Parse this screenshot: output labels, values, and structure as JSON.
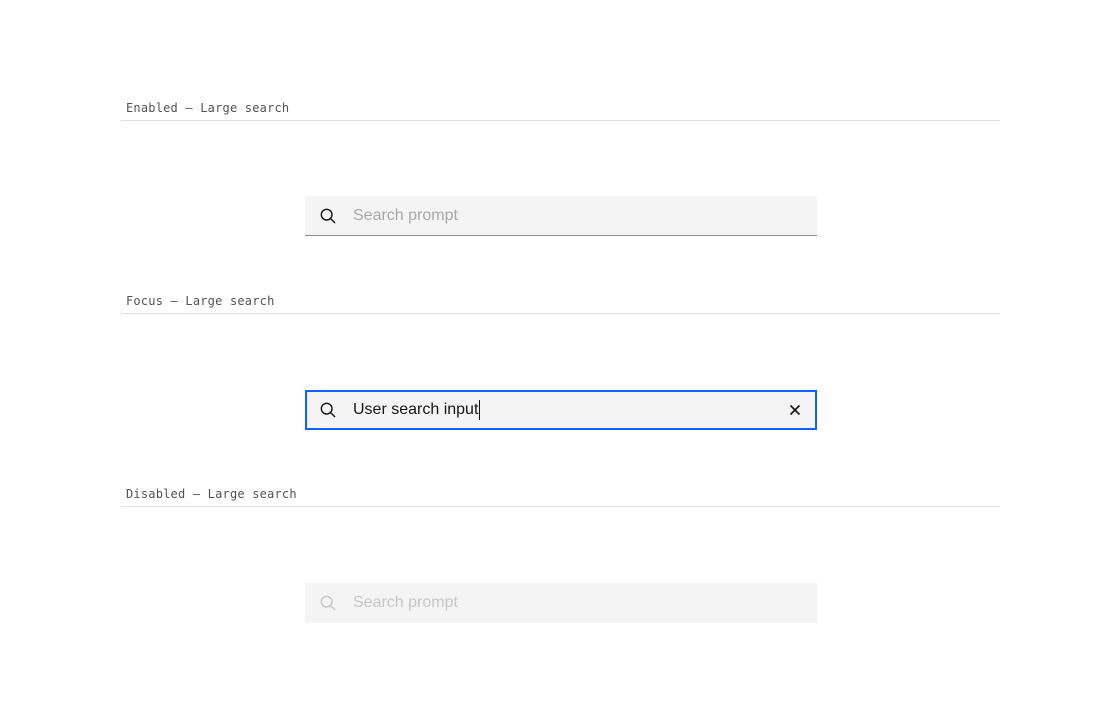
{
  "sections": [
    {
      "label": "Enabled – Large search",
      "placeholder": "Search prompt"
    },
    {
      "label": "Focus – Large search",
      "value": "User search input"
    },
    {
      "label": "Disabled – Large search",
      "placeholder": "Search prompt"
    }
  ],
  "icons": {
    "search": "search-icon",
    "clear": "close-icon"
  },
  "colors": {
    "focus_border": "#0f62fe",
    "field_bg": "#f4f4f4",
    "text": "#161616",
    "placeholder": "#a8a8a8",
    "disabled": "#c6c6c6"
  }
}
